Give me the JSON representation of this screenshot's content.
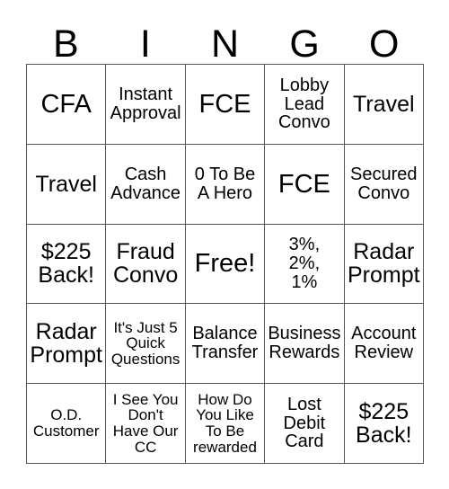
{
  "header": {
    "letters": [
      "B",
      "I",
      "N",
      "G",
      "O"
    ]
  },
  "grid": {
    "rows": 5,
    "columns": 5,
    "border_color": "#555555",
    "background_color": "#ffffff",
    "text_color": "#000000",
    "cells": [
      {
        "text": "CFA",
        "size": "xl"
      },
      {
        "text": "Instant\nApproval",
        "size": "md"
      },
      {
        "text": "FCE",
        "size": "xl"
      },
      {
        "text": "Lobby\nLead\nConvo",
        "size": "md"
      },
      {
        "text": "Travel",
        "size": "lg"
      },
      {
        "text": "Travel",
        "size": "lg"
      },
      {
        "text": "Cash\nAdvance",
        "size": "md"
      },
      {
        "text": "0 To Be\nA Hero",
        "size": "md"
      },
      {
        "text": "FCE",
        "size": "xl"
      },
      {
        "text": "Secured\nConvo",
        "size": "md"
      },
      {
        "text": "$225\nBack!",
        "size": "lg"
      },
      {
        "text": "Fraud\nConvo",
        "size": "lg"
      },
      {
        "text": "Free!",
        "size": "xl"
      },
      {
        "text": "3%,\n2%,\n1%",
        "size": "md"
      },
      {
        "text": "Radar\nPrompt",
        "size": "lg"
      },
      {
        "text": "Radar\nPrompt",
        "size": "lg"
      },
      {
        "text": "It's Just 5\nQuick\nQuestions",
        "size": "sm"
      },
      {
        "text": "Balance\nTransfer",
        "size": "md"
      },
      {
        "text": "Business\nRewards",
        "size": "md"
      },
      {
        "text": "Account\nReview",
        "size": "md"
      },
      {
        "text": "O.D.\nCustomer",
        "size": "sm"
      },
      {
        "text": "I See You\nDon't\nHave Our\nCC",
        "size": "sm"
      },
      {
        "text": "How Do\nYou Like\nTo Be\nrewarded",
        "size": "sm"
      },
      {
        "text": "Lost\nDebit\nCard",
        "size": "md"
      },
      {
        "text": "$225\nBack!",
        "size": "lg"
      }
    ]
  }
}
